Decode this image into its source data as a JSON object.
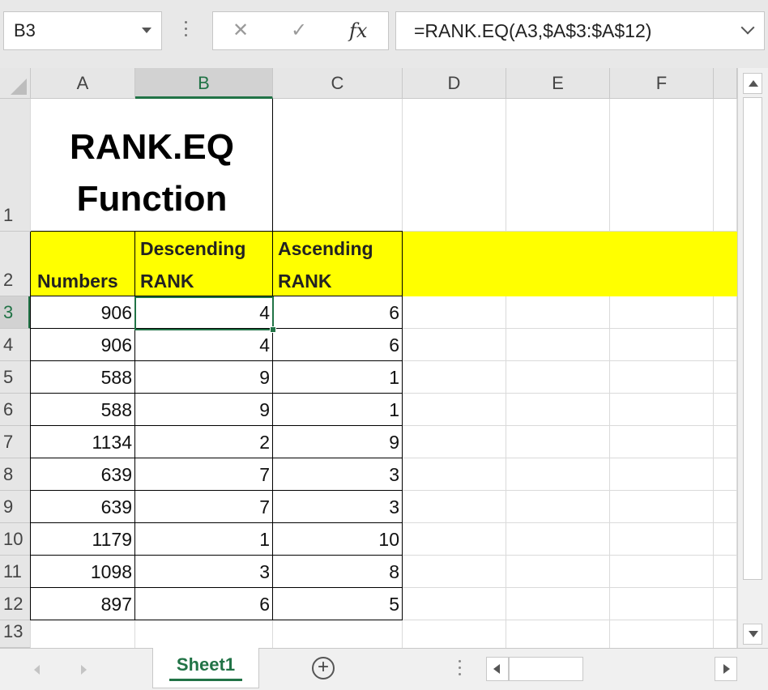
{
  "formula_bar": {
    "name_box": "B3",
    "cancel_glyph": "✕",
    "enter_glyph": "✓",
    "fx_label": "fx",
    "formula": "=RANK.EQ(A3,$A$3:$A$12)"
  },
  "columns": [
    "A",
    "B",
    "C",
    "D",
    "E",
    "F"
  ],
  "selected_column": "B",
  "rows": [
    "1",
    "2",
    "3",
    "4",
    "5",
    "6",
    "7",
    "8",
    "9",
    "10",
    "11",
    "12",
    "13"
  ],
  "selected_row": "3",
  "title": {
    "line1": "RANK.EQ",
    "line2": "Function"
  },
  "headers": {
    "numbers": "Numbers",
    "desc_line1": "Descending",
    "desc_line2": "RANK",
    "asc_line1": "Ascending",
    "asc_line2": "RANK"
  },
  "table": [
    {
      "number": "906",
      "desc": "4",
      "asc": "6"
    },
    {
      "number": "906",
      "desc": "4",
      "asc": "6"
    },
    {
      "number": "588",
      "desc": "9",
      "asc": "1"
    },
    {
      "number": "588",
      "desc": "9",
      "asc": "1"
    },
    {
      "number": "1134",
      "desc": "2",
      "asc": "9"
    },
    {
      "number": "639",
      "desc": "7",
      "asc": "3"
    },
    {
      "number": "639",
      "desc": "7",
      "asc": "3"
    },
    {
      "number": "1179",
      "desc": "1",
      "asc": "10"
    },
    {
      "number": "1098",
      "desc": "3",
      "asc": "8"
    },
    {
      "number": "897",
      "desc": "6",
      "asc": "5"
    }
  ],
  "sheet_tab": "Sheet1",
  "add_sheet_glyph": "+",
  "colors": {
    "accent": "#217346",
    "highlight": "#ffff00"
  }
}
